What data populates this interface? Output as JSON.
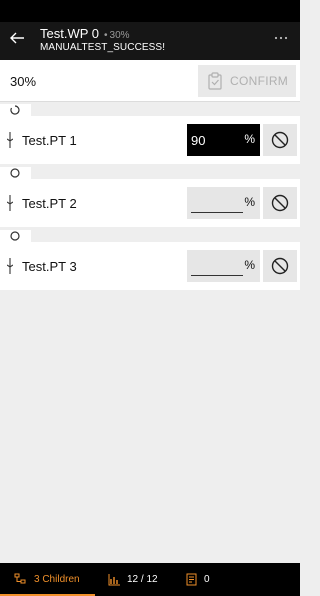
{
  "header": {
    "title": "Test.WP 0",
    "separator": "•",
    "percent": "30%",
    "subtitle": "MANUALTEST_SUCCESS!",
    "back_icon": "arrow-left-icon",
    "more_icon": "more-dots-icon"
  },
  "progress": {
    "value": "30%",
    "confirm_label": "CONFIRM",
    "confirm_icon": "clipboard-check-icon"
  },
  "rows": [
    {
      "name": "Test.PT 1",
      "value": "90",
      "unit": "%",
      "active": true
    },
    {
      "name": "Test.PT 2",
      "value": "",
      "unit": "%",
      "active": false
    },
    {
      "name": "Test.PT 3",
      "value": "",
      "unit": "%",
      "active": false
    }
  ],
  "bottom_nav": {
    "children_label": "3 Children",
    "progress_label": "12 / 12",
    "notes_label": "0"
  },
  "colors": {
    "accent": "#f0902a",
    "header_bg": "#161616",
    "background": "#eeeeee"
  }
}
